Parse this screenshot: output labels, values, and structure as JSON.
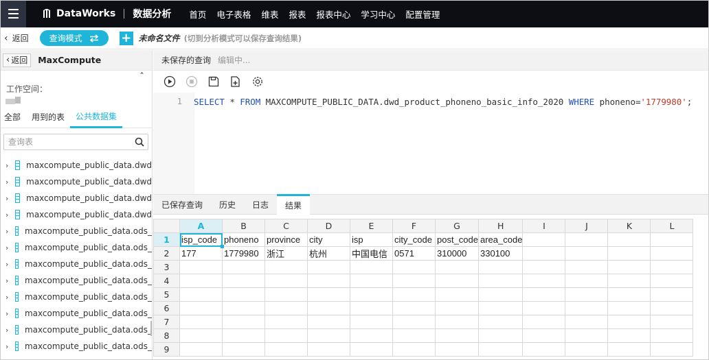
{
  "topbar": {
    "brand": "DataWorks",
    "module": "数据分析",
    "nav": [
      "首页",
      "电子表格",
      "维表",
      "报表",
      "报表中心",
      "学习中心",
      "配置管理"
    ]
  },
  "toolbar": {
    "back": "返回",
    "mode": "查询模式",
    "file_name": "未命名文件",
    "file_hint": "(切到分析模式可以保存查询结果)"
  },
  "left": {
    "back": "返回",
    "title": "MaxCompute",
    "workspace_label": "工作空间：",
    "tabs": [
      "全部",
      "用到的表",
      "公共数据集"
    ],
    "active_tab": 2,
    "search_placeholder": "查询表",
    "tables": [
      "maxcompute_public_data.dwd",
      "maxcompute_public_data.dwd",
      "maxcompute_public_data.dwd",
      "maxcompute_public_data.dwd",
      "maxcompute_public_data.ods_",
      "maxcompute_public_data.ods_",
      "maxcompute_public_data.ods_",
      "maxcompute_public_data.ods_",
      "maxcompute_public_data.ods_",
      "maxcompute_public_data.ods_",
      "maxcompute_public_data.ods_",
      "maxcompute_public_data.ods_"
    ]
  },
  "query": {
    "title": "未保存的查询",
    "status": "编辑中...",
    "line_number": "1",
    "sql": {
      "kw_select": "SELECT",
      "star": " * ",
      "kw_from": "FROM",
      "table": " MAXCOMPUTE_PUBLIC_DATA.dwd_product_phoneno_basic_info_2020 ",
      "kw_where": "WHERE",
      "cond": " phoneno=",
      "value": "'1779980'",
      "end": ";"
    }
  },
  "result_tabs": [
    "已保存查询",
    "历史",
    "日志",
    "结果"
  ],
  "active_result_tab": 3,
  "sheet": {
    "columns": [
      "A",
      "B",
      "C",
      "D",
      "E",
      "F",
      "G",
      "H",
      "I",
      "J",
      "K",
      "L"
    ],
    "rows": [
      [
        "isp_code",
        "phoneno",
        "province",
        "city",
        "isp",
        "city_code",
        "post_code",
        "area_code",
        "",
        "",
        "",
        ""
      ],
      [
        "177",
        "1779980",
        "浙江",
        "杭州",
        "中国电信",
        "0571",
        "310000",
        "330100",
        "",
        "",
        "",
        ""
      ],
      [
        "",
        "",
        "",
        "",
        "",
        "",
        "",
        "",
        "",
        "",
        "",
        ""
      ],
      [
        "",
        "",
        "",
        "",
        "",
        "",
        "",
        "",
        "",
        "",
        "",
        ""
      ],
      [
        "",
        "",
        "",
        "",
        "",
        "",
        "",
        "",
        "",
        "",
        "",
        ""
      ],
      [
        "",
        "",
        "",
        "",
        "",
        "",
        "",
        "",
        "",
        "",
        "",
        ""
      ],
      [
        "",
        "",
        "",
        "",
        "",
        "",
        "",
        "",
        "",
        "",
        "",
        ""
      ],
      [
        "",
        "",
        "",
        "",
        "",
        "",
        "",
        "",
        "",
        "",
        "",
        ""
      ],
      [
        "",
        "",
        "",
        "",
        "",
        "",
        "",
        "",
        "",
        "",
        "",
        ""
      ]
    ],
    "row_numbers": [
      "1",
      "2",
      "3",
      "4",
      "5",
      "6",
      "7",
      "8",
      "9"
    ],
    "selected_column": "A",
    "selected_row": "1"
  },
  "colors": {
    "accent": "#1fb5d8",
    "topbar": "#0c0e14",
    "keyword": "#1f4fb5",
    "string": "#c0392b"
  }
}
